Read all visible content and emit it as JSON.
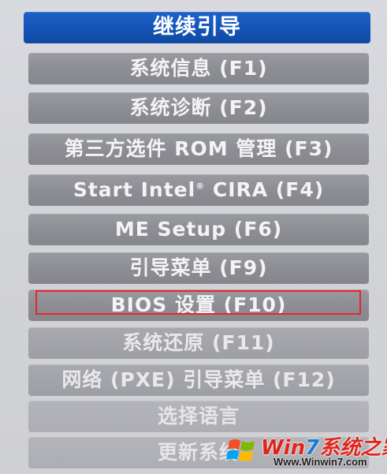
{
  "boot_menu": {
    "items": [
      {
        "label": "继续引导",
        "selected": true
      },
      {
        "label": "系统信息 (F1)"
      },
      {
        "label": "系统诊断 (F2)"
      },
      {
        "label": "第三方选件 ROM 管理 (F3)"
      },
      {
        "label_pre": "Start Intel",
        "label_sup": "®",
        "label_post": " CIRA (F4)"
      },
      {
        "label": "ME Setup (F6)"
      },
      {
        "label": "引导菜单 (F9)"
      },
      {
        "label": "BIOS 设置 (F10)",
        "highlighted": true
      },
      {
        "label": "系统还原 (F11)"
      },
      {
        "label": "网络 (PXE) 引导菜单 (F12)"
      },
      {
        "label": "选择语言"
      },
      {
        "label": "更新系统"
      }
    ]
  },
  "watermark": {
    "title_part1": "Win",
    "title_part2": "7",
    "title_part3": "系统之家",
    "url": "Www.Winwin7.com"
  },
  "colors": {
    "selected_bg": "#1452b3",
    "item_bg": "#8c8d92",
    "highlight_border": "#e8262a",
    "watermark_red": "#e2231a",
    "watermark_blue": "#1b7ad6"
  },
  "icons": {
    "watermark_logo": "windows-flag-icon"
  }
}
